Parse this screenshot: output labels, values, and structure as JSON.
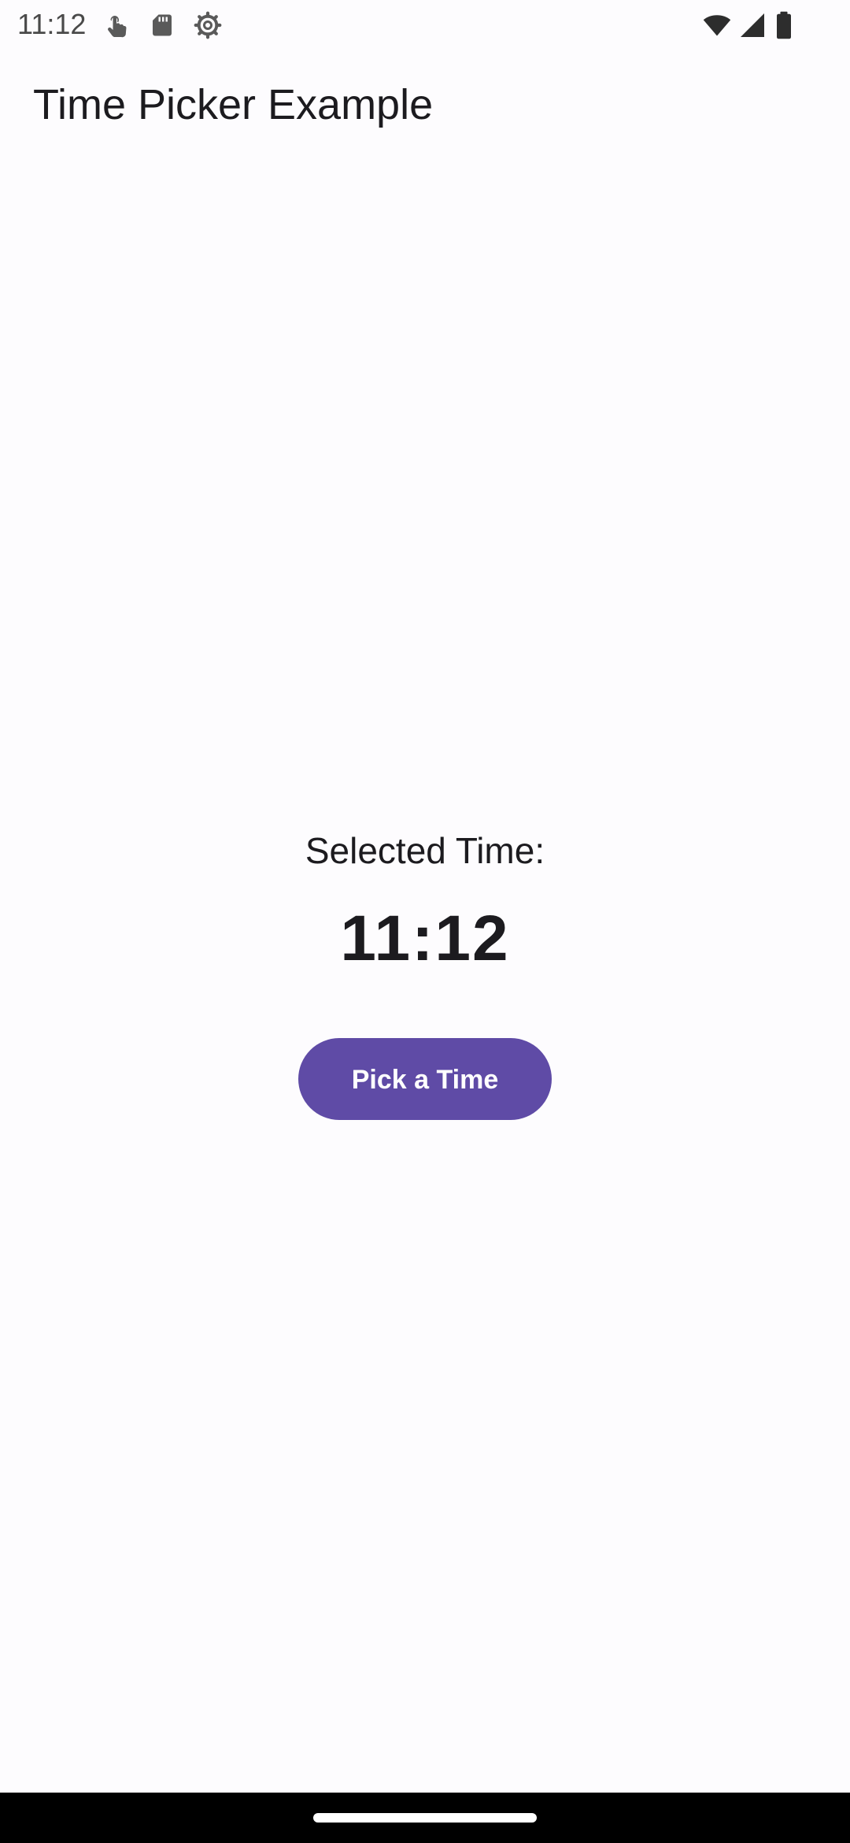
{
  "status_bar": {
    "time": "11:12",
    "left_icons": [
      "touch-icon",
      "sd-card-icon",
      "settings-gear-icon"
    ],
    "right_icons": [
      "wifi-icon",
      "cell-signal-icon",
      "battery-icon"
    ]
  },
  "app_bar": {
    "title": "Time Picker Example"
  },
  "main": {
    "selected_label": "Selected Time:",
    "selected_time": "11:12",
    "pick_button_label": "Pick a Time"
  },
  "colors": {
    "accent": "#5f4ba6",
    "background": "#fdfcfe",
    "text": "#1c1b1f"
  }
}
